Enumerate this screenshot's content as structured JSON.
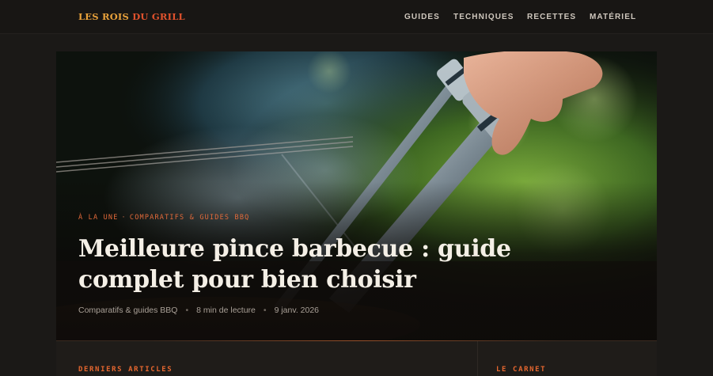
{
  "site": {
    "logo_part1": "LES ROIS ",
    "logo_part2": "DU GRILL"
  },
  "nav": {
    "items": [
      {
        "label": "GUIDES"
      },
      {
        "label": "TECHNIQUES"
      },
      {
        "label": "RECETTES"
      },
      {
        "label": "MATÉRIEL"
      }
    ]
  },
  "hero": {
    "kicker_1": "À LA UNE",
    "kicker_sep": "·",
    "kicker_2": "COMPARATIFS & GUIDES BBQ",
    "title": "Meilleure pince barbecue : guide complet pour bien choisir",
    "meta": {
      "category": "Comparatifs & guides BBQ",
      "read_time": "8 min de lecture",
      "date": "9 janv. 2026",
      "dot": "•"
    }
  },
  "sections": {
    "latest_label": "DERNIERS ARTICLES",
    "notebook_label": "LE CARNET"
  },
  "colors": {
    "accent": "#e4662f",
    "logo_gold": "#e9a23b",
    "logo_red": "#e0522d",
    "background": "#1b1917"
  }
}
